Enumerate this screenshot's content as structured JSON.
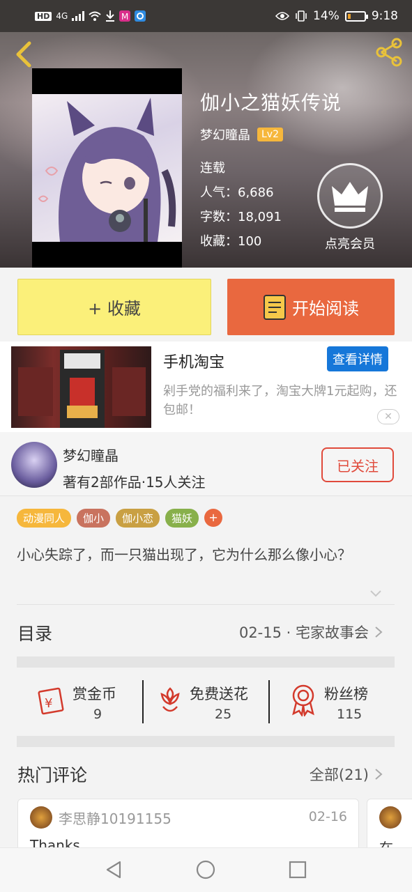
{
  "status_bar": {
    "left_badge": "HD",
    "network": "4G",
    "battery": "14%",
    "time": "9:18"
  },
  "book": {
    "title": "伽小之猫妖传说",
    "author": "梦幻瞳晶",
    "level": "Lv2",
    "status": "连载",
    "popularity": "人气：6,686",
    "word_count": "字数：18,091",
    "favorites": "收藏：100",
    "vip_label": "点亮会员"
  },
  "actions": {
    "favorite": "+ 收藏",
    "read": "开始阅读"
  },
  "ad": {
    "title": "手机淘宝",
    "detail_button": "查看详情",
    "description": "剁手党的福利来了，淘宝大牌1元起购，还包邮！",
    "close": "✕"
  },
  "author_card": {
    "name": "梦幻瞳晶",
    "stats": "著有2部作品·15人关注",
    "follow_button": "已关注"
  },
  "tags": [
    {
      "label": "动漫同人",
      "color": "#f6b73c"
    },
    {
      "label": "伽小",
      "color": "#c9735f"
    },
    {
      "label": "伽小恋",
      "color": "#c9a043"
    },
    {
      "label": "猫妖",
      "color": "#88b04b"
    }
  ],
  "tag_add": "+",
  "synopsis": "小心失踪了，而一只猫出现了，它为什么那么像小心？",
  "toc": {
    "label": "目录",
    "latest": "02-15 · 宅家故事会"
  },
  "stats": {
    "reward": {
      "label": "赏金币",
      "value": "9"
    },
    "flowers": {
      "label": "免费送花",
      "value": "25"
    },
    "fans": {
      "label": "粉丝榜",
      "value": "115"
    }
  },
  "comments": {
    "label": "热门评论",
    "all": "全部(21)",
    "items": [
      {
        "user": "李思静10191155",
        "date": "02-16",
        "text": "Thanks"
      }
    ],
    "peek_text": "在"
  },
  "colors": {
    "accent_orange": "#e9683f",
    "fav_yellow": "#fbf07a",
    "follow_red": "#e04a3b",
    "detail_blue": "#1677d9",
    "icon_red": "#d33a2c"
  }
}
